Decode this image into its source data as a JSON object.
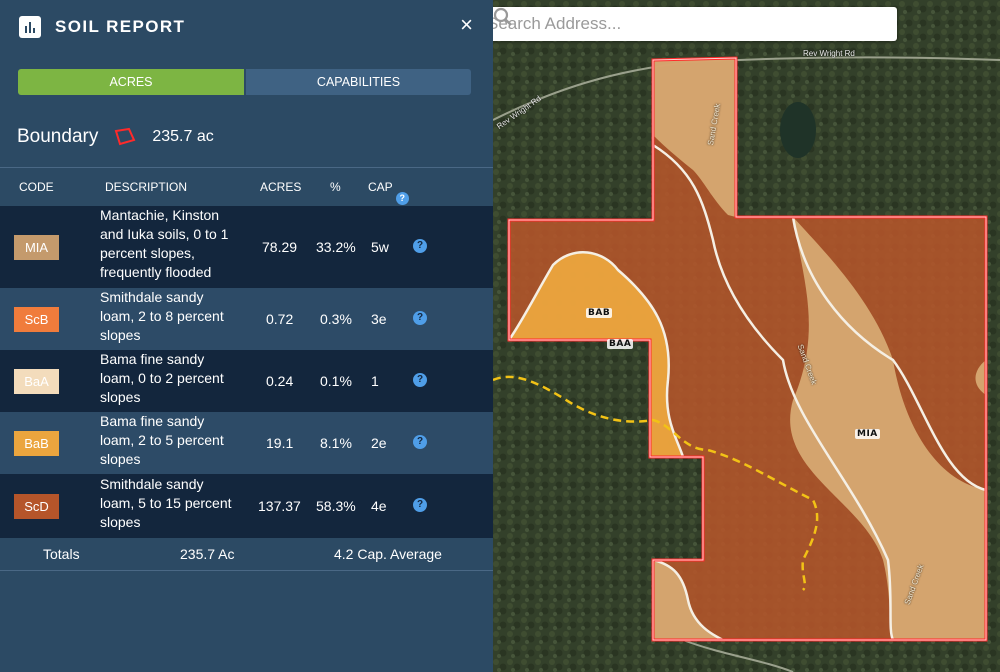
{
  "panel": {
    "title": "SOIL REPORT",
    "close": "×"
  },
  "tabs": [
    {
      "label": "ACRES"
    },
    {
      "label": "CAPABILITIES"
    }
  ],
  "boundary": {
    "label": "Boundary",
    "value": "235.7 ac"
  },
  "table": {
    "headers": {
      "code": "CODE",
      "description": "DESCRIPTION",
      "acres": "ACRES",
      "percent": "%",
      "cap": "CAP"
    },
    "rows": [
      {
        "code": "MIA",
        "color": "#c49a6c",
        "description": "Mantachie, Kinston and Iuka soils, 0 to 1 percent slopes, frequently flooded",
        "acres": "78.29",
        "percent": "33.2%",
        "cap": "5w"
      },
      {
        "code": "ScB",
        "color": "#f07c3c",
        "description": "Smithdale sandy loam, 2 to 8 percent slopes",
        "acres": "0.72",
        "percent": "0.3%",
        "cap": "3e"
      },
      {
        "code": "BaA",
        "color": "#f3dcbc",
        "description": "Bama fine sandy loam, 0 to 2 percent slopes",
        "acres": "0.24",
        "percent": "0.1%",
        "cap": "1"
      },
      {
        "code": "BaB",
        "color": "#eba53e",
        "description": "Bama fine sandy loam, 2 to 5 percent slopes",
        "acres": "19.1",
        "percent": "8.1%",
        "cap": "2e"
      },
      {
        "code": "ScD",
        "color": "#b5552a",
        "description": "Smithdale sandy loam, 5 to 15 percent slopes",
        "acres": "137.37",
        "percent": "58.3%",
        "cap": "4e"
      }
    ]
  },
  "totals": {
    "label": "Totals",
    "acres": "235.7 Ac",
    "cap_average": "4.2 Cap. Average"
  },
  "map": {
    "search_placeholder": "Search Address...",
    "labels": {
      "bab": "BAB",
      "baa": "BAA",
      "mia": "MIA"
    },
    "roads": {
      "rev_wright_top": "Rev Wright Rd",
      "rev_wright_left": "Rev Wright Rd",
      "sand_creek": "Sand Creek"
    },
    "colors": {
      "boundary": "#ff2a2a",
      "mia": "#d9ad75",
      "scd": "#b5552a",
      "bab": "#eba53e",
      "stream": "#f2c216"
    }
  }
}
